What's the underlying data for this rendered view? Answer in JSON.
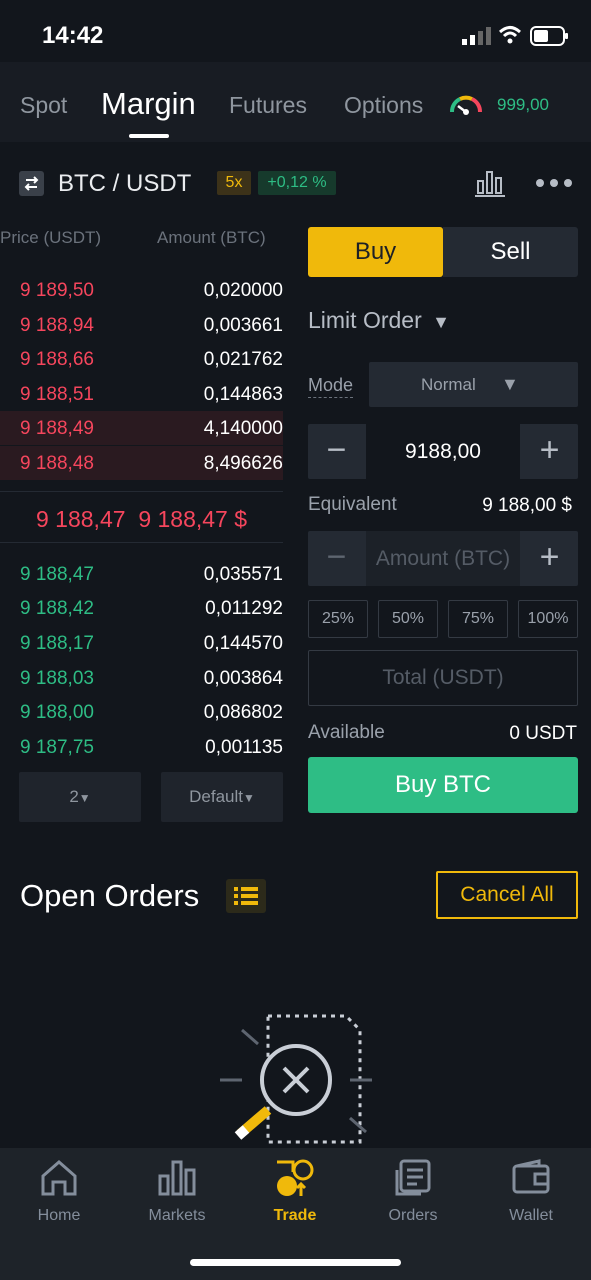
{
  "status": {
    "time": "14:42"
  },
  "tabs": {
    "spot": "Spot",
    "margin": "Margin",
    "futures": "Futures",
    "options": "Options"
  },
  "balance": "999,00",
  "pair": {
    "name": "BTC / USDT",
    "leverage": "5x",
    "change": "+0,12 %"
  },
  "orderbook": {
    "price_header": "Price (USDT)",
    "amount_header": "Amount (BTC)",
    "asks": [
      {
        "price": "9 189,50",
        "amount": "0,020000"
      },
      {
        "price": "9 188,94",
        "amount": "0,003661"
      },
      {
        "price": "9 188,66",
        "amount": "0,021762"
      },
      {
        "price": "9 188,51",
        "amount": "0,144863"
      },
      {
        "price": "9 188,49",
        "amount": "4,140000"
      },
      {
        "price": "9 188,48",
        "amount": "8,496626"
      }
    ],
    "mid_price": "9 188,47",
    "mid_price_usd": "9 188,47 $",
    "bids": [
      {
        "price": "9 188,47",
        "amount": "0,035571"
      },
      {
        "price": "9 188,42",
        "amount": "0,011292"
      },
      {
        "price": "9 188,17",
        "amount": "0,144570"
      },
      {
        "price": "9 188,03",
        "amount": "0,003864"
      },
      {
        "price": "9 188,00",
        "amount": "0,086802"
      },
      {
        "price": "9 187,75",
        "amount": "0,001135"
      }
    ],
    "precision": "2",
    "view": "Default"
  },
  "form": {
    "buy": "Buy",
    "sell": "Sell",
    "order_type": "Limit Order",
    "mode_label": "Mode",
    "mode_value": "Normal",
    "price_value": "9188,00",
    "equivalent_label": "Equivalent",
    "equivalent_value": "9 188,00 $",
    "amount_placeholder": "Amount (BTC)",
    "pct": [
      "25%",
      "50%",
      "75%",
      "100%"
    ],
    "total_placeholder": "Total (USDT)",
    "available_label": "Available",
    "available_value": "0 USDT",
    "submit": "Buy BTC"
  },
  "open_orders": {
    "title": "Open Orders",
    "cancel_all": "Cancel All"
  },
  "nav": {
    "home": "Home",
    "markets": "Markets",
    "trade": "Trade",
    "orders": "Orders",
    "wallet": "Wallet"
  },
  "colors": {
    "accent": "#f0b90b",
    "buy": "#2ebd85",
    "sell": "#f6465d",
    "bg": "#12161c"
  }
}
